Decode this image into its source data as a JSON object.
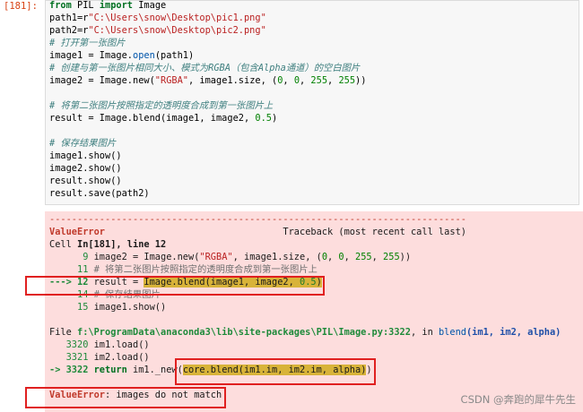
{
  "prompt": "[181]:",
  "code": {
    "l1_kw1": "from",
    "l1_mod": " PIL ",
    "l1_kw2": "import",
    "l1_name": " Image",
    "l2_pre": "path1=r",
    "l2_str": "\"C:\\Users\\snow\\Desktop\\pic1.png\"",
    "l3_pre": "path2=r",
    "l3_str": "\"C:\\Users\\snow\\Desktop\\pic2.png\"",
    "l4_cm": "# 打开第一张图片",
    "l5_pre": "image1 = Image.",
    "l5_fn": "open",
    "l5_post": "(path1)",
    "l6_cm": "# 创建与第一张图片相同大小、模式为RGBA（包含Alpha通道）的空白图片",
    "l7_pre": "image2 = Image.new(",
    "l7_str": "\"RGBA\"",
    "l7_mid": ", image1.size, (",
    "l7_n1": "0",
    "l7_c1": ", ",
    "l7_n2": "0",
    "l7_c2": ", ",
    "l7_n3": "255",
    "l7_c3": ", ",
    "l7_n4": "255",
    "l7_post": "))",
    "l9_cm": "# 将第二张图片按照指定的透明度合成到第一张图片上",
    "l10_pre": "result = Image.blend(image1, image2, ",
    "l10_num": "0.5",
    "l10_post": ")",
    "l12_cm": "# 保存结果图片",
    "l13": "image1.show()",
    "l14": "image2.show()",
    "l15": "result.show()",
    "l16": "result.save(path2)"
  },
  "traceback": {
    "dashes": "---------------------------------------------------------------------------",
    "err_name": "ValueError",
    "tb_label": "Traceback (most recent call last)",
    "cell_pre": "Cell ",
    "cell_ref": "In[181], line 12",
    "t9_no": "      9 ",
    "t9_pre": "image2 = Image.new(",
    "t9_str": "\"RGBA\"",
    "t9_mid": ", image1.size, (",
    "t9_n1": "0",
    "t9_c1": ", ",
    "t9_n2": "0",
    "t9_c2": ", ",
    "t9_n3": "255",
    "t9_c3": ", ",
    "t9_n4": "255",
    "t9_post": "))",
    "t11_no": "     11 ",
    "t11_cm": "# 将第二张图片按照指定的透明度合成到第一张图片上",
    "t12_arrow": "---> 12 ",
    "t12_pre": "result = ",
    "t12_hl": "Image.blend(image1, image2, ",
    "t12_num": "0.5",
    "t12_post": ")",
    "t14_no": "     14 ",
    "t14_cm": "# 保存结果图片",
    "t15_no": "     15 ",
    "t15": "image1.show()",
    "file_pre": "File ",
    "file_path": "f:\\ProgramData\\anaconda3\\lib\\site-packages\\PIL\\Image.py:3322",
    "file_mid": ", in ",
    "file_fn": "blend",
    "file_args": "(im1, im2, alpha)",
    "f3320_no": "   3320 ",
    "f3320": "im1.load()",
    "f3321_no": "   3321 ",
    "f3321": "im2.load()",
    "f3322_arrow": "-> 3322 ",
    "f3322_kw": "return",
    "f3322_pre": " im1._new(",
    "f3322_hl": "core.blend(im1.im, im2.im, alpha)",
    "f3322_post": ")",
    "final_name": "ValueError",
    "final_msg": ": images do not match"
  },
  "watermark": "CSDN @奔跑的犀牛先生"
}
